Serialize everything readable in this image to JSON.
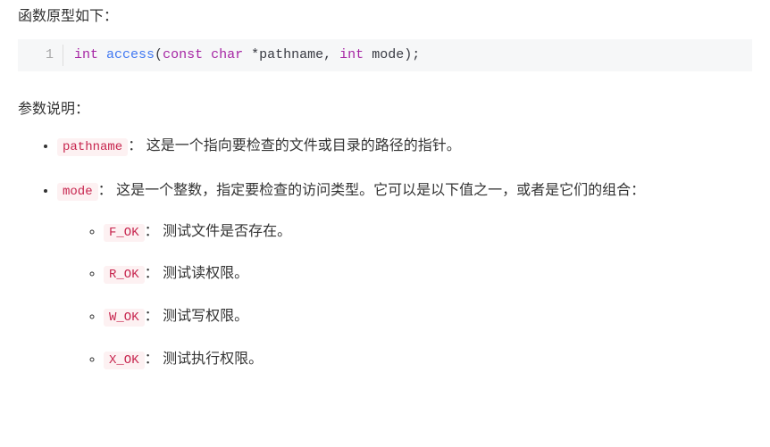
{
  "intro": "函数原型如下：",
  "code": {
    "lineno": "1",
    "t_int1": "int",
    "t_func": "access",
    "t_lp": "(",
    "t_const": "const",
    "t_char": "char",
    "t_star": "*",
    "t_arg1": "pathname",
    "t_comma": ", ",
    "t_int2": "int",
    "t_arg2": "mode",
    "t_rp": ")",
    "t_semi": ";"
  },
  "params_heading": "参数说明：",
  "params": [
    {
      "name": "pathname",
      "sep": "：",
      "desc": "这是一个指向要检查的文件或目录的路径的指针。"
    },
    {
      "name": "mode",
      "sep": "：",
      "desc": "这是一个整数，指定要检查的访问类型。它可以是以下值之一，或者是它们的组合：",
      "sub": [
        {
          "name": "F_OK",
          "sep": "：",
          "desc": "测试文件是否存在。"
        },
        {
          "name": "R_OK",
          "sep": "：",
          "desc": "测试读权限。"
        },
        {
          "name": "W_OK",
          "sep": "：",
          "desc": "测试写权限。"
        },
        {
          "name": "X_OK",
          "sep": "：",
          "desc": "测试执行权限。"
        }
      ]
    }
  ]
}
